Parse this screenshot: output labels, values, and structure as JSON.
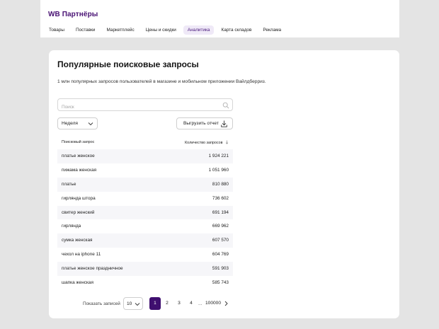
{
  "brand": "WB Партнёры",
  "nav": [
    {
      "label": "Товары",
      "active": false
    },
    {
      "label": "Поставки",
      "active": false
    },
    {
      "label": "Маркетплейс",
      "active": false
    },
    {
      "label": "Цены и скидки",
      "active": false
    },
    {
      "label": "Аналитика",
      "active": true
    },
    {
      "label": "Карта складов",
      "active": false
    },
    {
      "label": "Реклама",
      "active": false
    }
  ],
  "page": {
    "title": "Популярные поисковые запросы",
    "description": "1 млн популярных запросов пользователей в магазине и мобильном приложении Вайлдберриз."
  },
  "search": {
    "placeholder": "Поиск",
    "value": "",
    "icon": "search-icon"
  },
  "period": {
    "selected": "Неделя",
    "icon": "chevron-down-icon"
  },
  "export": {
    "label": "Выгрузить отчет",
    "icon": "download-icon"
  },
  "table": {
    "columns": {
      "query": "Поисковый запрос",
      "count": "Количество запросов"
    },
    "rows": [
      {
        "query": "платье женское",
        "count": "1 924 221"
      },
      {
        "query": "пижама женская",
        "count": "1 051 960"
      },
      {
        "query": "платье",
        "count": "810 880"
      },
      {
        "query": "гирлянда штора",
        "count": "736 602"
      },
      {
        "query": "свитер женский",
        "count": "691 194"
      },
      {
        "query": "гирлянда",
        "count": "669 962"
      },
      {
        "query": "сумка женская",
        "count": "607 570"
      },
      {
        "query": "чехол на iphone 11",
        "count": "604 769"
      },
      {
        "query": "платье женское праздничное",
        "count": "591 903"
      },
      {
        "query": "шапка женская",
        "count": "585 743"
      }
    ]
  },
  "pagination": {
    "label": "Показать записей",
    "per_page": "10",
    "pages": [
      "1",
      "2",
      "3",
      "4"
    ],
    "current": "1",
    "dots": "...",
    "last": "100000"
  },
  "colors": {
    "brand": "#481173",
    "accent": "#3f0f6f",
    "nav_active_bg": "#efe9f7"
  }
}
